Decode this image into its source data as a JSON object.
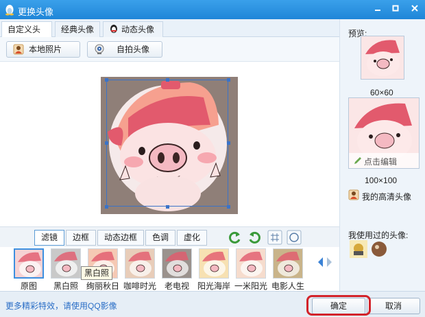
{
  "window": {
    "title": "更换头像",
    "minimize_icon": "minimize-icon",
    "maximize_icon": "maximize-icon",
    "close_icon": "close-icon"
  },
  "tabs": [
    {
      "label": "自定义头像",
      "active": true
    },
    {
      "label": "经典头像",
      "active": false
    },
    {
      "label": "动态头像",
      "active": false
    }
  ],
  "toolbar": {
    "local_photo": "本地照片",
    "selfie": "自拍头像"
  },
  "filter_tabs": [
    {
      "label": "滤镜",
      "active": true
    },
    {
      "label": "边框",
      "active": false
    },
    {
      "label": "动态边框",
      "active": false
    },
    {
      "label": "色调",
      "active": false
    },
    {
      "label": "虚化",
      "active": false
    }
  ],
  "filters": [
    {
      "label": "原图",
      "selected": true,
      "tint": "#f6d2d4"
    },
    {
      "label": "黑白照",
      "selected": false,
      "tint": "#c9c9c9"
    },
    {
      "label": "绚丽秋日",
      "selected": false,
      "tint": "#f5c9b4"
    },
    {
      "label": "咖啡时光",
      "selected": false,
      "tint": "#e8cdb9"
    },
    {
      "label": "老电视",
      "selected": false,
      "tint": "#9a928d"
    },
    {
      "label": "阳光海岸",
      "selected": false,
      "tint": "#f7e1b2"
    },
    {
      "label": "一米阳光",
      "selected": false,
      "tint": "#f6dccd"
    },
    {
      "label": "电影人生",
      "selected": false,
      "tint": "#c9b48a"
    }
  ],
  "tooltip": "黑白照",
  "preview": {
    "label": "预览:",
    "small_size": "60×60",
    "large_size": "100×100",
    "edit_label": "点击编辑"
  },
  "hd_avatar": "我的高清头像",
  "used_avatars_label": "我使用过的头像:",
  "footer": {
    "more_effects": "更多精彩特效，请使用QQ影像",
    "ok": "确定",
    "cancel": "取消"
  },
  "colors": {
    "titlebar": "#2b93e0",
    "accent": "#3c8fe0",
    "highlight": "#d2232a"
  }
}
